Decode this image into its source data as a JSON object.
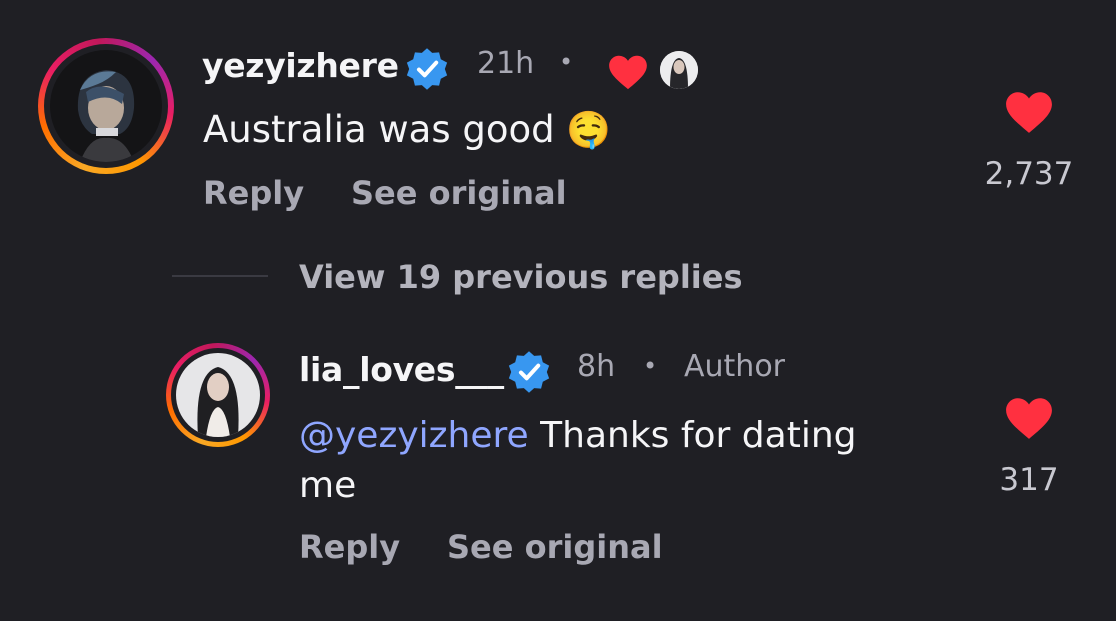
{
  "comments": [
    {
      "username": "yezyizhere",
      "time": "21h",
      "separator": "•",
      "text": "Australia was good",
      "emoji": "🤤",
      "actions": {
        "reply": "Reply",
        "see_original": "See original"
      },
      "likes": "2,737",
      "author_liked": true,
      "verified": true
    },
    {
      "username": "lia_loves___",
      "time": "8h",
      "separator": "•",
      "tag": "Author",
      "mention": "@yezyizhere",
      "text_line1": " Thanks for dating",
      "text_line2": "me",
      "actions": {
        "reply": "Reply",
        "see_original": "See original"
      },
      "likes": "317",
      "verified": true
    }
  ],
  "thread": {
    "view_replies": "View 19 previous replies"
  },
  "colors": {
    "background": "#1f1f24",
    "heart": "#ff3040",
    "verified": "#3897f0",
    "mention": "#8fa6ff",
    "muted": "#a8a8b3"
  }
}
